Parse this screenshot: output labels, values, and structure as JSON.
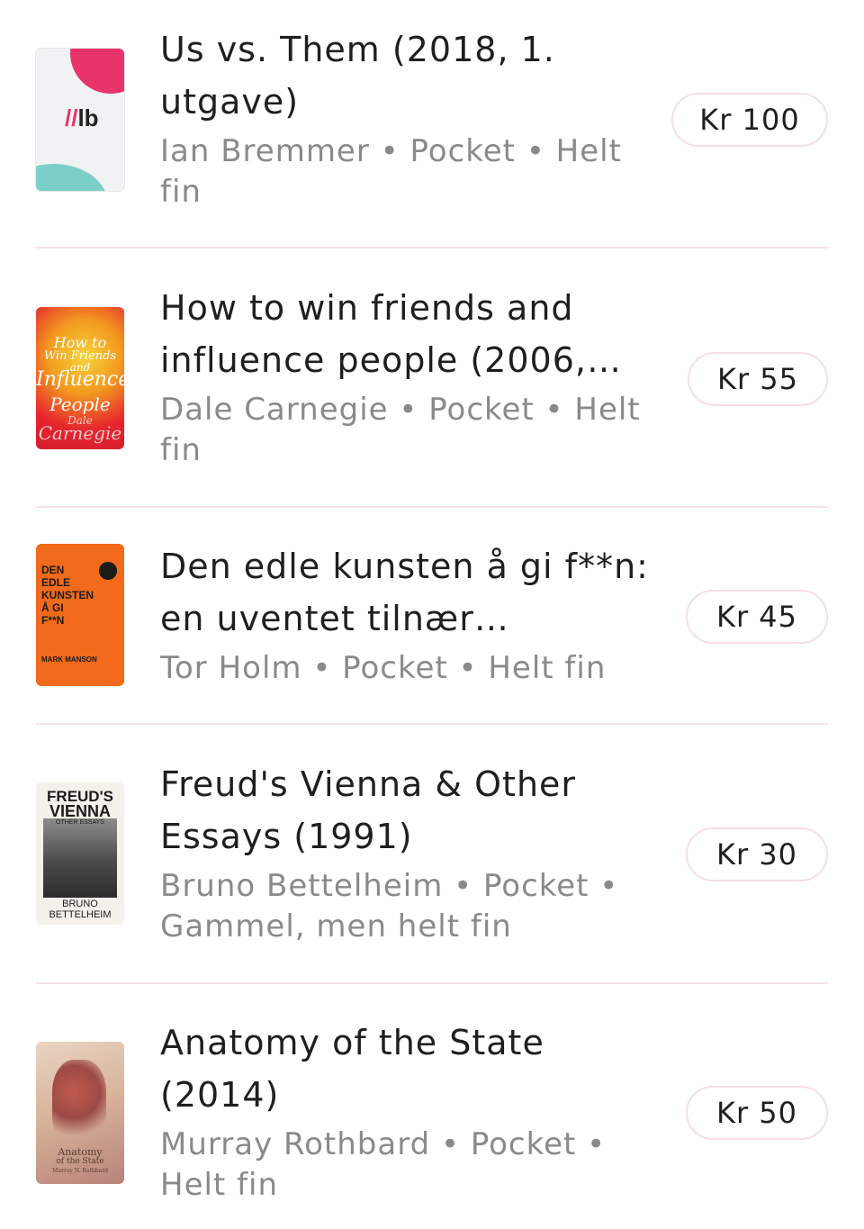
{
  "items": [
    {
      "title": "Us vs. Them (2018, 1. utgave)",
      "meta": "Ian Bremmer • Pocket • Helt fin",
      "price": "Kr 100",
      "cover": {
        "icon": "lb-logo-cover",
        "logo_text": "lb"
      }
    },
    {
      "title": "How to win friends and influence people (2006,…",
      "meta": "Dale Carnegie • Pocket • Helt fin",
      "price": "Kr 55",
      "cover": {
        "lines": [
          "How to",
          "Win Friends",
          "and",
          "Influence",
          "People",
          "Dale",
          "Carnegie"
        ]
      }
    },
    {
      "title": "Den edle kunsten å gi f**n: en uventet tilnær…",
      "meta": "Tor Holm • Pocket • Helt fin",
      "price": "Kr 45",
      "cover": {
        "lines": [
          "DEN",
          "EDLE",
          "KUNSTEN",
          "Å GI",
          "F**N",
          "MARK MANSON"
        ]
      }
    },
    {
      "title": "Freud's Vienna & Other Essays (1991)",
      "meta": "Bruno Bettelheim • Pocket • Gammel, men helt fin",
      "price": "Kr 30",
      "cover": {
        "lines": [
          "FREUD'S",
          "VIENNA",
          "OTHER ESSAYS",
          "BRUNO",
          "BETTELHEIM"
        ]
      }
    },
    {
      "title": "Anatomy of the State (2014)",
      "meta": "Murray Rothbard • Pocket • Helt fin",
      "price": "Kr 50",
      "cover": {
        "lines": [
          "Anatomy",
          "of the State",
          "Murray N. Rothbard"
        ]
      }
    }
  ],
  "colors": {
    "title": "#1f1f1f",
    "meta": "#8a8a8a",
    "price_border": "#f5dfe3",
    "divider": "#f6e4e8"
  }
}
